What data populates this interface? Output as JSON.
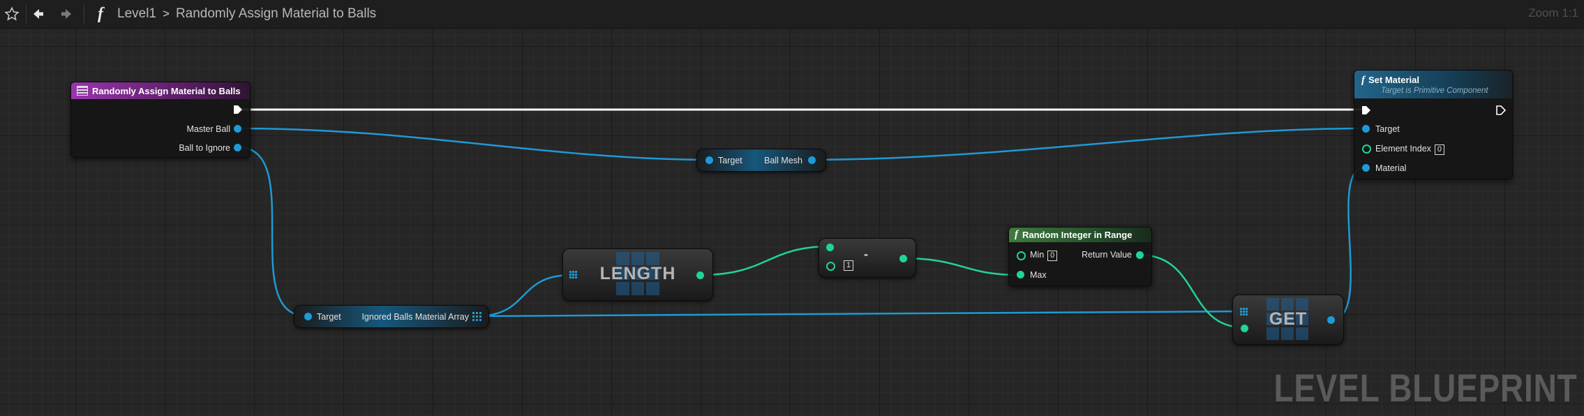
{
  "toolbar": {
    "function_icon": "function-icon",
    "breadcrumb": [
      "Level1",
      "Randomly Assign Material to Balls"
    ],
    "zoom": "Zoom 1:1"
  },
  "colors": {
    "exec_wire": "#ffffff",
    "object_wire": "#1e9ad6",
    "integer_wire": "#1fd49a",
    "function_header": "#1c5977",
    "pure_function_header": "#2b5a2b",
    "event_header": "#8f2fa0"
  },
  "nodes": {
    "entry": {
      "title": "Randomly Assign Material to Balls",
      "outputs": [
        "Master Ball",
        "Ball to Ignore"
      ]
    },
    "get_ball_mesh": {
      "input": "Target",
      "output": "Ball Mesh"
    },
    "get_ignored_array": {
      "input": "Target",
      "output": "Ignored Balls Material Array"
    },
    "length": {
      "label": "LENGTH"
    },
    "subtract": {
      "label": "-",
      "value": "1"
    },
    "random_int": {
      "title": "Random Integer in Range",
      "inputs": [
        {
          "name": "Min",
          "value": "0"
        },
        {
          "name": "Max"
        }
      ],
      "output": "Return Value"
    },
    "get": {
      "label": "GET"
    },
    "set_material": {
      "title": "Set Material",
      "subtitle": "Target is Primitive Component",
      "inputs": [
        {
          "name": "Target"
        },
        {
          "name": "Element Index",
          "value": "0"
        },
        {
          "name": "Material"
        }
      ]
    }
  },
  "watermark": "LEVEL BLUEPRINT"
}
